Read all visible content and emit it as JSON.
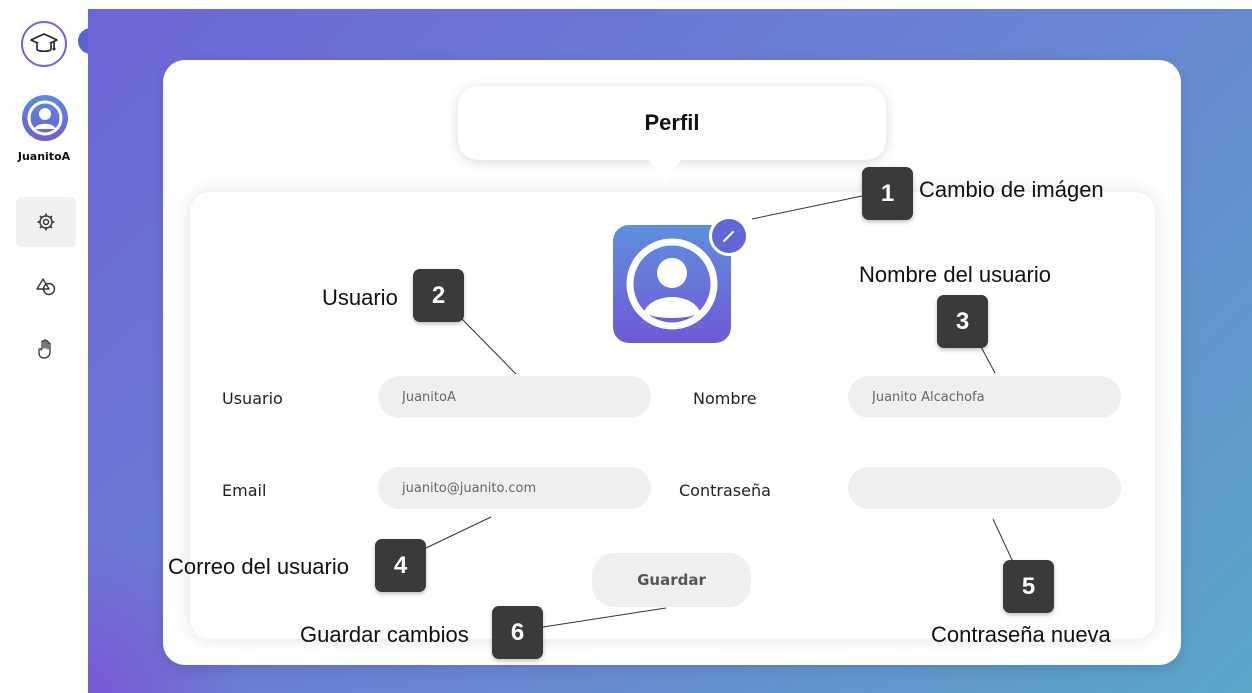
{
  "sidebar": {
    "username": "JuanitoA",
    "nav_items": [
      "settings",
      "shapes",
      "hand-pointer"
    ]
  },
  "page": {
    "title": "Perfil"
  },
  "form": {
    "usuario_label": "Usuario",
    "usuario_value": "JuanitoA",
    "nombre_label": "Nombre",
    "nombre_value": "Juanito Alcachofa",
    "email_label": "Email",
    "email_value": "juanito@juanito.com",
    "password_label": "Contraseña",
    "password_value": "",
    "save_label": "Guardar"
  },
  "annotations": [
    {
      "number": "1",
      "text": "Cambio de imágen"
    },
    {
      "number": "2",
      "text": "Usuario"
    },
    {
      "number": "3",
      "text": "Nombre del usuario"
    },
    {
      "number": "4",
      "text": "Correo del usuario"
    },
    {
      "number": "5",
      "text": "Contraseña nueva"
    },
    {
      "number": "6",
      "text": "Guardar cambios"
    }
  ],
  "colors": {
    "accent": "#6168d5",
    "gradient_start": "#6d66d8",
    "gradient_end": "#5aa6c9",
    "badge": "#3a3a3a"
  }
}
